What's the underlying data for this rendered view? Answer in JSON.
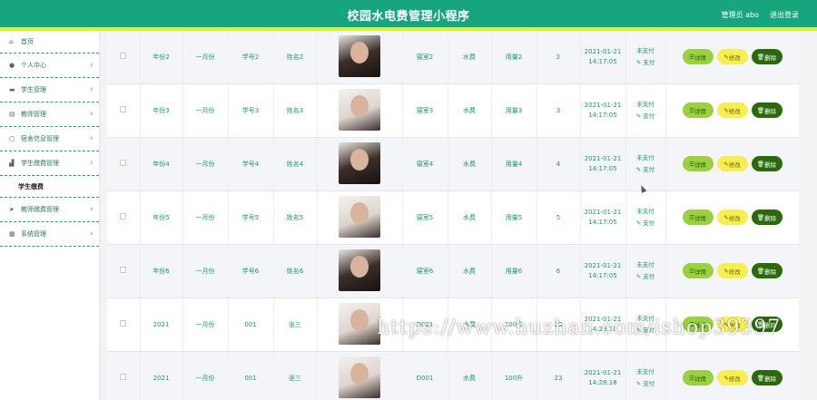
{
  "header": {
    "title": "校园水电费管理小程序",
    "user_label": "管理员 abo",
    "logout_label": "退出登录"
  },
  "sidebar": {
    "items": [
      {
        "label": "首页",
        "icon": "home-icon"
      },
      {
        "label": "个人中心",
        "icon": "user-icon"
      },
      {
        "label": "学生管理",
        "icon": "monitor-icon"
      },
      {
        "label": "教师管理",
        "icon": "doc-icon"
      },
      {
        "label": "宿舍信息管理",
        "icon": "chat-icon"
      },
      {
        "label": "学生缴费管理",
        "icon": "chart-icon"
      },
      {
        "label": "教师缴费管理",
        "icon": "send-icon"
      },
      {
        "label": "系统管理",
        "icon": "grid-icon"
      }
    ],
    "subitem_label": "学生缴费"
  },
  "table": {
    "rows": [
      {
        "year": "年份2",
        "month": "一月份",
        "student_no": "学号2",
        "name": "姓名2",
        "photo": "dark",
        "dorm": "寝室2",
        "fee_type": "水费",
        "usage": "用量2",
        "amount": "2",
        "time_date": "2021-01-21",
        "time_clock": "14:17:05",
        "status": "未支付",
        "pay_label": "支付"
      },
      {
        "year": "年份3",
        "month": "一月份",
        "student_no": "学号3",
        "name": "姓名3",
        "photo": "light",
        "dorm": "寝室3",
        "fee_type": "水费",
        "usage": "用量3",
        "amount": "3",
        "time_date": "2021-01-21",
        "time_clock": "14:17:05",
        "status": "未支付",
        "pay_label": "支付"
      },
      {
        "year": "年份4",
        "month": "一月份",
        "student_no": "学号4",
        "name": "姓名4",
        "photo": "dark",
        "dorm": "寝室4",
        "fee_type": "水费",
        "usage": "用量4",
        "amount": "4",
        "time_date": "2021-01-21",
        "time_clock": "14:17:05",
        "status": "未支付",
        "pay_label": "支付"
      },
      {
        "year": "年份5",
        "month": "一月份",
        "student_no": "学号5",
        "name": "姓名5",
        "photo": "light",
        "dorm": "寝室5",
        "fee_type": "水费",
        "usage": "用量5",
        "amount": "5",
        "time_date": "2021-01-21",
        "time_clock": "14:17:05",
        "status": "未支付",
        "pay_label": "支付"
      },
      {
        "year": "年份6",
        "month": "一月份",
        "student_no": "学号6",
        "name": "姓名6",
        "photo": "dark",
        "dorm": "寝室6",
        "fee_type": "水费",
        "usage": "用量6",
        "amount": "6",
        "time_date": "2021-01-21",
        "time_clock": "14:17:05",
        "status": "未支付",
        "pay_label": "支付"
      },
      {
        "year": "2021",
        "month": "一月份",
        "student_no": "001",
        "name": "张三",
        "photo": "light",
        "dorm": "D001",
        "fee_type": "水费",
        "usage": "100升",
        "amount": "23",
        "time_date": "2021-01-21",
        "time_clock": "14:28:18",
        "status": "未支付",
        "pay_label": "支付"
      },
      {
        "year": "2021",
        "month": "一月份",
        "student_no": "001",
        "name": "张三",
        "photo": "light",
        "dorm": "D001",
        "fee_type": "水费",
        "usage": "100升",
        "amount": "23",
        "time_date": "2021-01-21",
        "time_clock": "14:28:18",
        "status": "未支付",
        "pay_label": "支付"
      }
    ],
    "actions": {
      "detail": "详情",
      "edit": "修改",
      "delete": "删除"
    }
  },
  "watermark": "https://www.huzhan.com/ishop39397",
  "colors": {
    "header": "#17a57e",
    "accent_strip": "#d7f23a",
    "text_green": "#1b9a6e",
    "detail_btn": "#9bd13f",
    "edit_btn": "#f7ef52",
    "delete_btn": "#2a6a0a"
  }
}
